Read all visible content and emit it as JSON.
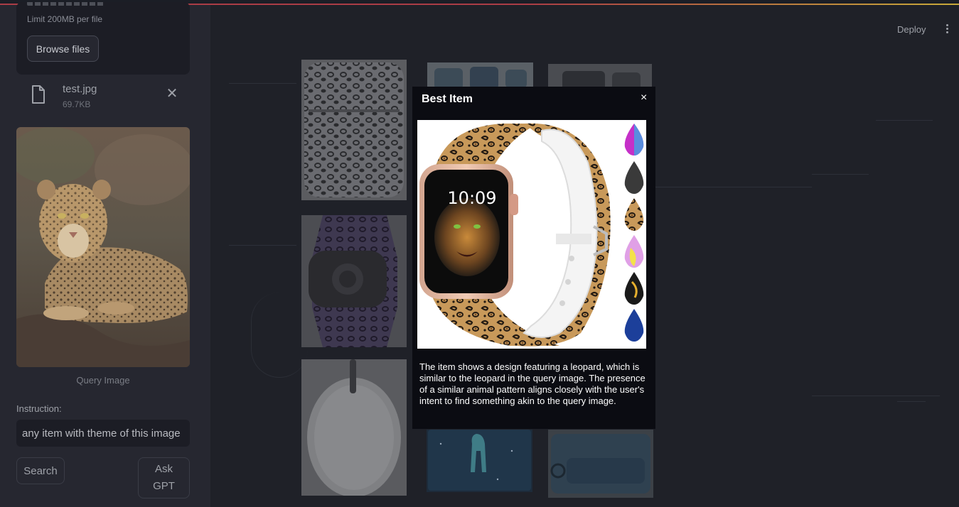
{
  "header": {
    "deploy_label": "Deploy",
    "menu_icon": "more-vertical-icon"
  },
  "sidebar": {
    "upload_limit": "Limit 200MB per file",
    "browse_label": "Browse files",
    "file": {
      "name": "test.jpg",
      "size": "69.7KB",
      "icon": "file-icon",
      "remove_icon": "close-icon"
    },
    "query_caption": "Query Image",
    "instruction_label": "Instruction:",
    "instruction_value": "any item with theme of this image",
    "search_label": "Search",
    "ask_gpt_label": "Ask GPT"
  },
  "modal": {
    "title": "Best Item",
    "close_glyph": "×",
    "watch_time": "10:09",
    "explanation": "The item shows a design featuring a leopard, which is similar to the leopard in the query image. The presence of a similar animal pattern aligns closely with the user's intent to find something akin to the query image."
  },
  "colors": {
    "app_bg": "#0e1117",
    "sidebar_bg": "#262730",
    "main_bg_dimmed": "#1f2128",
    "modal_bg": "#0b0c12"
  }
}
